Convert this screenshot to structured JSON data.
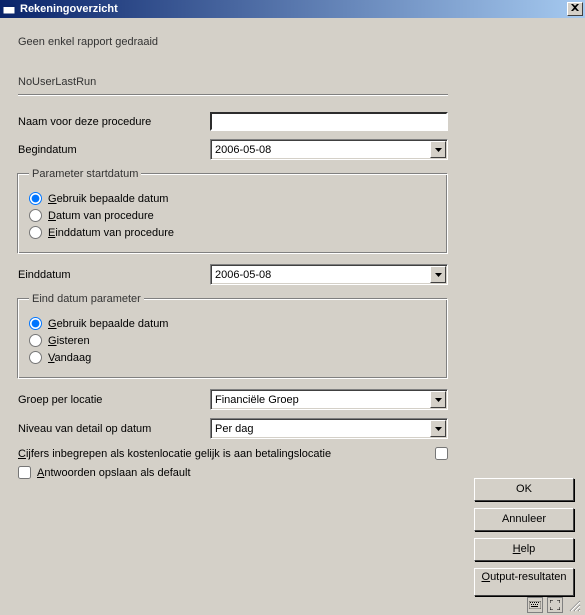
{
  "window": {
    "title": "Rekeningoverzicht"
  },
  "content": {
    "status_msg": "Geen enkel rapport gedraaid",
    "last_user": "NoUserLastRun"
  },
  "labels": {
    "procedure_name": "Naam voor deze procedure",
    "begin_date": "Begindatum",
    "end_date": "Einddatum",
    "group_location": "Groep per locatie",
    "detail_level": "Niveau van detail op datum",
    "param_start_legend": "Parameter startdatum",
    "param_end_legend": "Eind datum parameter",
    "radio_use_date": "ebruik bepaalde datum",
    "radio_proc_date": "atum van procedure",
    "radio_end_proc": "inddatum van procedure",
    "radio_yesterday": "isteren",
    "radio_today": "andaag",
    "chk_figures": "ijfers inbegrepen als kostenlocatie gelijk is aan betalingslocatie",
    "chk_save_default": "ntwoorden opslaan als default"
  },
  "values": {
    "procedure_name": "",
    "begin_date": "2006-05-08",
    "end_date": "2006-05-08",
    "group_location": "Financiële Groep",
    "detail_level": "Per dag"
  },
  "buttons": {
    "ok": "OK",
    "cancel": "Annuleer",
    "help": "elp",
    "output": "utput-resultaten"
  }
}
